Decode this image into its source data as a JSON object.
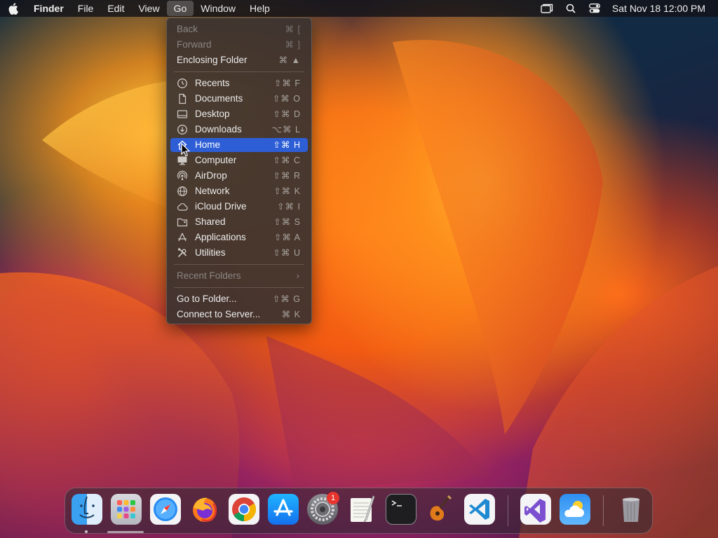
{
  "menubar": {
    "app_name": "Finder",
    "menus": [
      "File",
      "Edit",
      "View",
      "Go",
      "Window",
      "Help"
    ],
    "active_menu": "Go",
    "clock": "Sat Nov 18  12:00 PM"
  },
  "go_menu": {
    "items": [
      {
        "label": "Back",
        "shortcut": "⌘ [",
        "disabled": true
      },
      {
        "label": "Forward",
        "shortcut": "⌘ ]",
        "disabled": true
      },
      {
        "label": "Enclosing Folder",
        "shortcut": "⌘ ▲"
      },
      {
        "label": "Recents",
        "shortcut": "⇧⌘ F",
        "icon": "clock-icon"
      },
      {
        "label": "Documents",
        "shortcut": "⇧⌘ O",
        "icon": "document-icon"
      },
      {
        "label": "Desktop",
        "shortcut": "⇧⌘ D",
        "icon": "desktop-icon"
      },
      {
        "label": "Downloads",
        "shortcut": "⌥⌘ L",
        "icon": "download-icon"
      },
      {
        "label": "Home",
        "shortcut": "⇧⌘ H",
        "icon": "home-icon",
        "selected": true
      },
      {
        "label": "Computer",
        "shortcut": "⇧⌘ C",
        "icon": "computer-icon"
      },
      {
        "label": "AirDrop",
        "shortcut": "⇧⌘ R",
        "icon": "airdrop-icon"
      },
      {
        "label": "Network",
        "shortcut": "⇧⌘ K",
        "icon": "globe-icon"
      },
      {
        "label": "iCloud Drive",
        "shortcut": "⇧⌘ I",
        "icon": "cloud-icon"
      },
      {
        "label": "Shared",
        "shortcut": "⇧⌘ S",
        "icon": "shared-folder-icon"
      },
      {
        "label": "Applications",
        "shortcut": "⇧⌘ A",
        "icon": "applications-icon"
      },
      {
        "label": "Utilities",
        "shortcut": "⇧⌘ U",
        "icon": "tools-icon"
      },
      {
        "label": "Recent Folders",
        "disabled": true,
        "submenu": true
      },
      {
        "label": "Go to Folder...",
        "shortcut": "⇧⌘ G"
      },
      {
        "label": "Connect to Server...",
        "shortcut": "⌘ K"
      }
    ]
  },
  "dock": {
    "apps": [
      "Finder",
      "Launchpad",
      "Safari",
      "Firefox",
      "Chrome",
      "App Store",
      "System Settings",
      "TextEdit",
      "Terminal",
      "GarageBand",
      "Visual Studio Code",
      "Visual Studio",
      "Weather",
      "Trash"
    ],
    "system_settings_badge": "1"
  },
  "colors": {
    "menu_highlight": "#2d5ed6",
    "badge": "#e8352e"
  }
}
